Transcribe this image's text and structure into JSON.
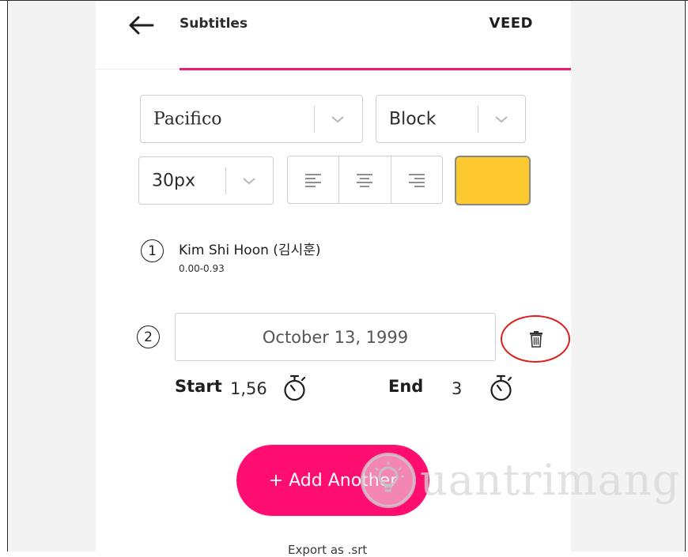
{
  "header": {
    "title": "Subtitles",
    "brand": "VEED"
  },
  "font_select": {
    "value": "Pacifico"
  },
  "style_select": {
    "value": "Block"
  },
  "size_select": {
    "value": "30px"
  },
  "text_color": "#fdc92e",
  "subtitles": [
    {
      "index": "1",
      "text": "Kim Shi Hoon (김시훈)",
      "time": "0.00-0.93"
    },
    {
      "index": "2",
      "text": "October 13, 1999",
      "start_label": "Start",
      "start_value": "1,56",
      "end_label": "End",
      "end_value": "3"
    }
  ],
  "add_button_label": "+ Add Another",
  "watermark_text": "uantrimang",
  "export_label": "Export as .srt",
  "colors": {
    "accent": "#ef1b6f",
    "button": "#ff0d70",
    "highlight_ring": "#e01d1d"
  }
}
